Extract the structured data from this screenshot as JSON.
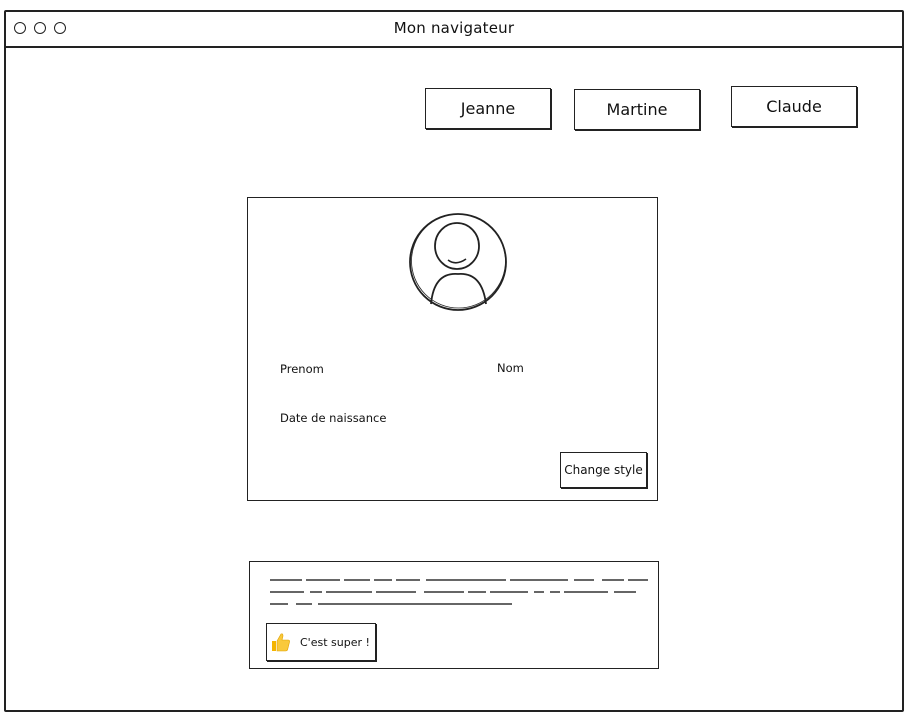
{
  "window": {
    "title": "Mon navigateur"
  },
  "tabs": [
    {
      "label": "Jeanne"
    },
    {
      "label": "Martine"
    },
    {
      "label": "Claude"
    }
  ],
  "profile": {
    "avatar_icon": "user-avatar-icon",
    "fields": {
      "prenom": "Prenom",
      "nom": "Nom",
      "date_naissance": "Date de naissance"
    },
    "change_style_label": "Change style"
  },
  "comment": {
    "like_icon": "thumbs-up-icon",
    "like_label": "C'est super !"
  }
}
